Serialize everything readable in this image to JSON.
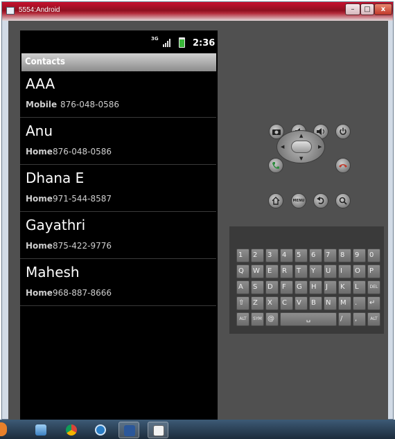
{
  "window": {
    "title": "5554:Android",
    "min_glyph": "–",
    "max_glyph": "□",
    "close_glyph": "x"
  },
  "statusbar": {
    "network": "3G",
    "time": "2:36"
  },
  "contacts": {
    "header": "Contacts",
    "items": [
      {
        "name": "AAA",
        "type": "Mobile",
        "phone": "876-048-0586"
      },
      {
        "name": "Anu",
        "type": "Home",
        "phone": "876-048-0586"
      },
      {
        "name": "Dhana E",
        "type": "Home",
        "phone": "971-544-8587"
      },
      {
        "name": "Gayathri",
        "type": "Home",
        "phone": "875-422-9776"
      },
      {
        "name": "Mahesh",
        "type": "Home",
        "phone": "968-887-8666"
      }
    ]
  },
  "controls": {
    "camera": "camera-icon",
    "volume_down": "volume-down-icon",
    "volume_up": "volume-up-icon",
    "power": "power-icon",
    "call": "call-icon",
    "end_call": "end-call-icon",
    "home": "home-icon",
    "menu_label": "MENU",
    "back": "back-icon",
    "search": "search-icon"
  },
  "keyboard": {
    "rows": [
      [
        "1",
        "2",
        "3",
        "4",
        "5",
        "6",
        "7",
        "8",
        "9",
        "0"
      ],
      [
        "Q",
        "W",
        "E",
        "R",
        "T",
        "Y",
        "U",
        "I",
        "O",
        "P"
      ],
      [
        "A",
        "S",
        "D",
        "F",
        "G",
        "H",
        "J",
        "K",
        "L",
        "DEL"
      ],
      [
        "⇧",
        "Z",
        "X",
        "C",
        "V",
        "B",
        "N",
        "M",
        ".",
        "↵"
      ]
    ],
    "bottom_row": {
      "alt_left": "ALT",
      "sym": "SYM",
      "at": "@",
      "space": "␣",
      "slash": "/",
      "comma": ",",
      "alt_right": "ALT"
    }
  },
  "taskbar": {
    "items": [
      "explorer-icon",
      "chrome-icon",
      "dell-icon",
      "word-icon",
      "document-icon"
    ]
  },
  "colors": {
    "screen_bg": "#000000",
    "emulator_bg": "#505050",
    "call_green": "#2e8b3e",
    "end_red": "#c0392b",
    "title_red": "#c8102e"
  }
}
